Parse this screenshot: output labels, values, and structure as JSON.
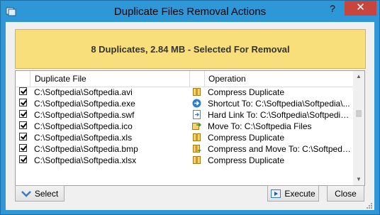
{
  "window": {
    "title": "Duplicate Files Removal Actions",
    "help": "?",
    "close": "✕"
  },
  "banner": {
    "text": "8 Duplicates, 2.84 MB - Selected For Removal"
  },
  "list": {
    "columns": {
      "file": "Duplicate File",
      "operation": "Operation"
    },
    "rows": [
      {
        "checked": true,
        "file": "C:\\Softpedia\\Softpedia.avi",
        "icon": "compress-icon",
        "operation": "Compress Duplicate"
      },
      {
        "checked": true,
        "file": "C:\\Softpedia\\Softpedia.exe",
        "icon": "shortcut-arrow-icon",
        "operation": "Shortcut To: C:\\Softpedia\\Softpedia\\..."
      },
      {
        "checked": true,
        "file": "C:\\Softpedia\\Softpedia.swf",
        "icon": "hard-link-icon",
        "operation": "Hard Link To: C:\\Softpedia\\Softpedia\\..."
      },
      {
        "checked": true,
        "file": "C:\\Softpedia\\Softpedia.ico",
        "icon": "move-icon",
        "operation": "Move To: C:\\Softpedia Files"
      },
      {
        "checked": true,
        "file": "C:\\Softpedia\\Softpedia.xls",
        "icon": "compress-icon",
        "operation": "Compress Duplicate"
      },
      {
        "checked": true,
        "file": "C:\\Softpedia\\Softpedia.bmp",
        "icon": "compress-move-icon",
        "operation": "Compress and Move To: C:\\Softpedia\\..."
      },
      {
        "checked": true,
        "file": "C:\\Softpedia\\Softpedia.xlsx",
        "icon": "compress-icon",
        "operation": "Compress Duplicate"
      }
    ]
  },
  "buttons": {
    "select": "Select",
    "execute": "Execute",
    "close": "Close"
  },
  "colors": {
    "titlebar": "#2d97d8",
    "close": "#c7453d",
    "banner": "#f8df7c"
  }
}
